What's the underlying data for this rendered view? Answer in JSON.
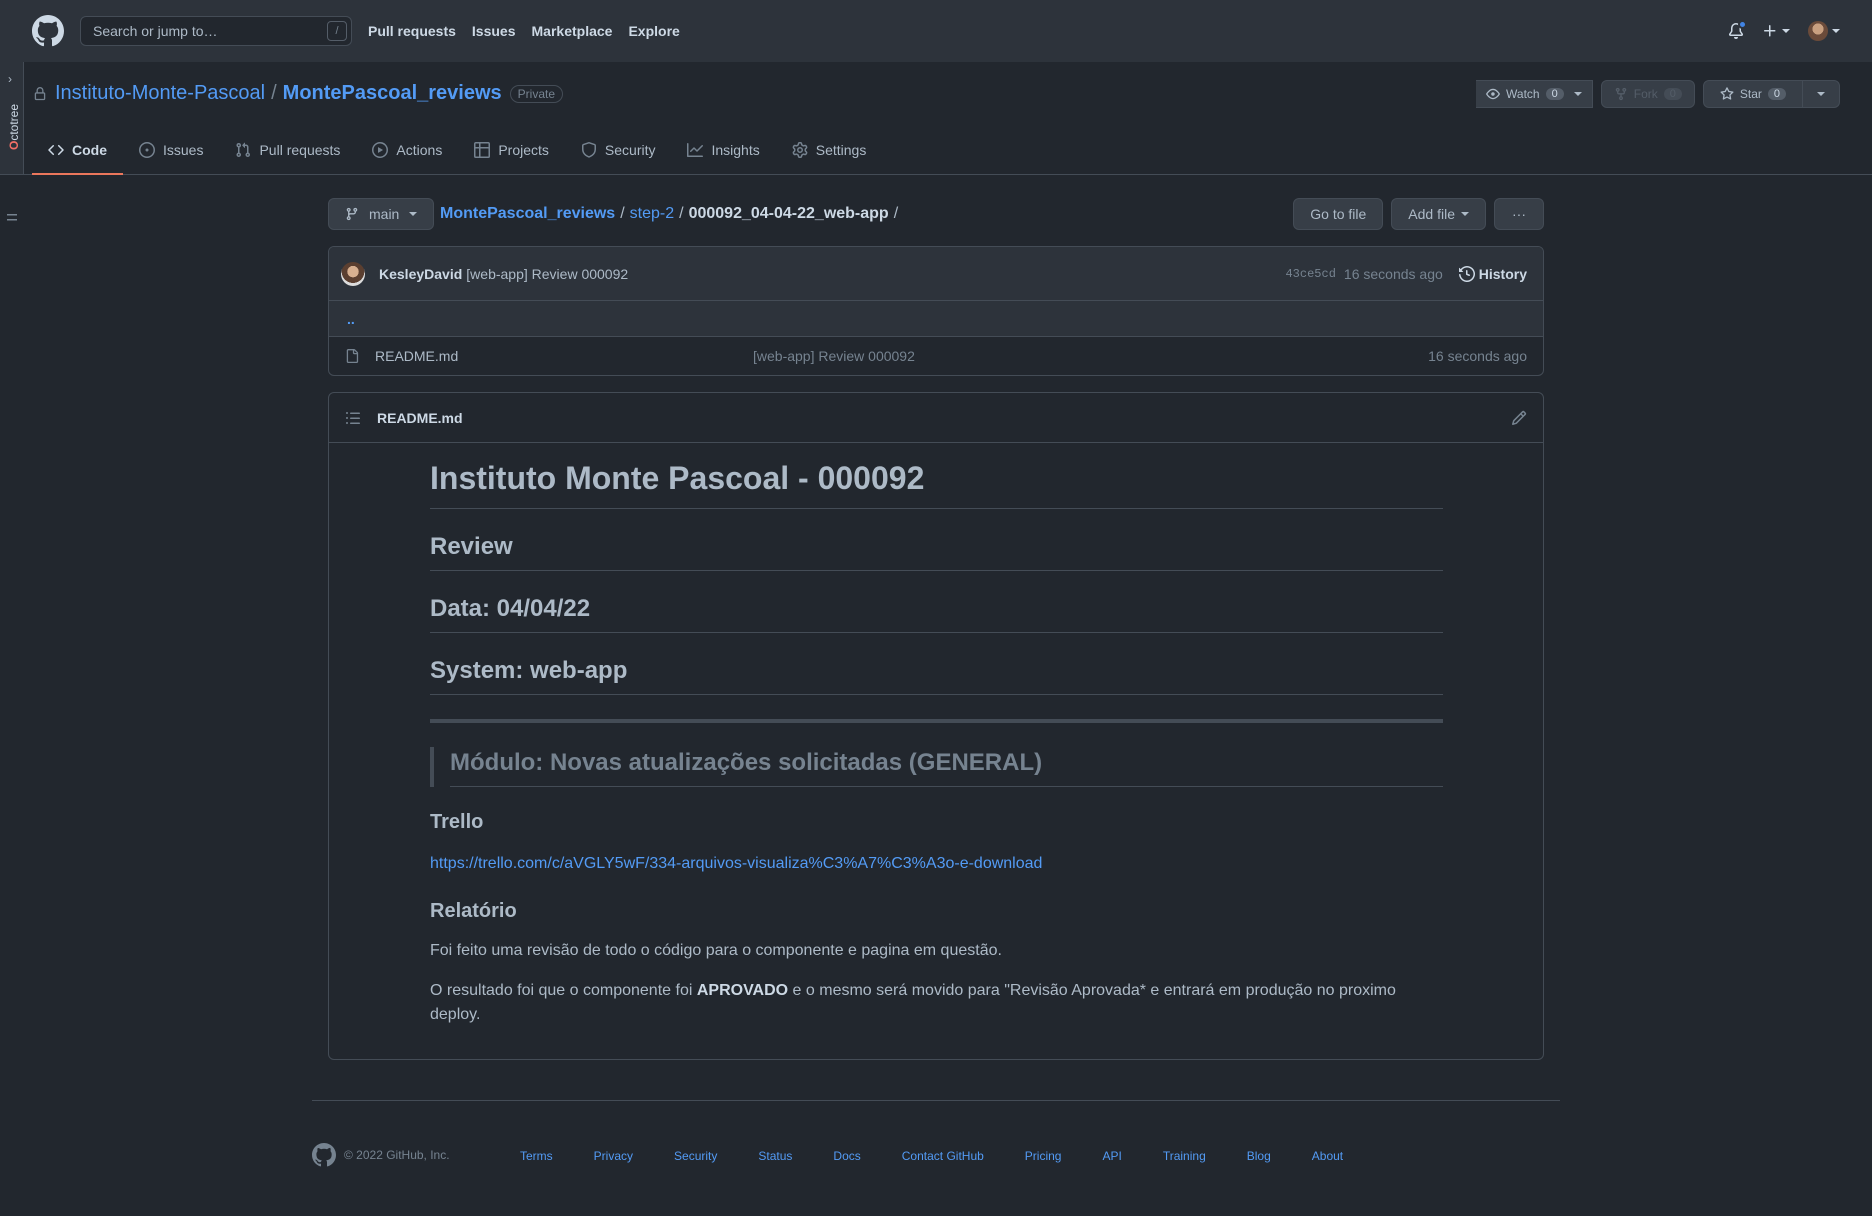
{
  "header": {
    "search_placeholder": "Search or jump to…",
    "search_key": "/",
    "nav": [
      "Pull requests",
      "Issues",
      "Marketplace",
      "Explore"
    ]
  },
  "octotree": {
    "label_o": "O",
    "label_rest": "ctotree"
  },
  "repo": {
    "owner": "Instituto-Monte-Pascoal",
    "separator": "/",
    "name": "MontePascoal_reviews",
    "visibility": "Private",
    "watch_label": "Watch",
    "watch_count": "0",
    "fork_label": "Fork",
    "fork_count": "0",
    "star_label": "Star",
    "star_count": "0",
    "tabs": [
      {
        "label": "Code",
        "icon": "code-icon"
      },
      {
        "label": "Issues",
        "icon": "issue-icon"
      },
      {
        "label": "Pull requests",
        "icon": "pull-request-icon"
      },
      {
        "label": "Actions",
        "icon": "play-icon"
      },
      {
        "label": "Projects",
        "icon": "table-icon"
      },
      {
        "label": "Security",
        "icon": "shield-icon"
      },
      {
        "label": "Insights",
        "icon": "graph-icon"
      },
      {
        "label": "Settings",
        "icon": "gear-icon"
      }
    ]
  },
  "filenav": {
    "branch": "main",
    "path": [
      "MontePascoal_reviews",
      "step-2",
      "000092_04-04-22_web-app"
    ],
    "go_to_file": "Go to file",
    "add_file": "Add file",
    "more": "···"
  },
  "commit": {
    "author": "KesleyDavid",
    "message": "[web-app] Review 000092",
    "sha": "43ce5cd",
    "time": "16 seconds ago",
    "history": "History"
  },
  "files": {
    "up": "..",
    "rows": [
      {
        "name": "README.md",
        "message": "[web-app] Review 000092",
        "time": "16 seconds ago"
      }
    ]
  },
  "readme": {
    "filename": "README.md",
    "h1": "Instituto Monte Pascoal - 000092",
    "h2_review": "Review",
    "h2_date": "Data: 04/04/22",
    "h2_system": "System: web-app",
    "quote": "Módulo: Novas atualizações solicitadas (GENERAL)",
    "h3_trello": "Trello",
    "trello_link": "https://trello.com/c/aVGLY5wF/334-arquivos-visualiza%C3%A7%C3%A3o-e-download",
    "h3_report": "Relatório",
    "p1": "Foi feito uma revisão de todo o código para o componente e pagina em questão.",
    "p2_before": "O resultado foi que o componente foi ",
    "p2_bold": "APROVADO",
    "p2_after": " e o mesmo será movido para \"Revisão Aprovada* e entrará em produção no proximo deploy."
  },
  "footer": {
    "copyright": "© 2022 GitHub, Inc.",
    "links": [
      "Terms",
      "Privacy",
      "Security",
      "Status",
      "Docs",
      "Contact GitHub",
      "Pricing",
      "API",
      "Training",
      "Blog",
      "About"
    ]
  },
  "colors": {
    "accent": "#539bf5",
    "tab_underline": "#ec775c",
    "background": "#22272e"
  }
}
